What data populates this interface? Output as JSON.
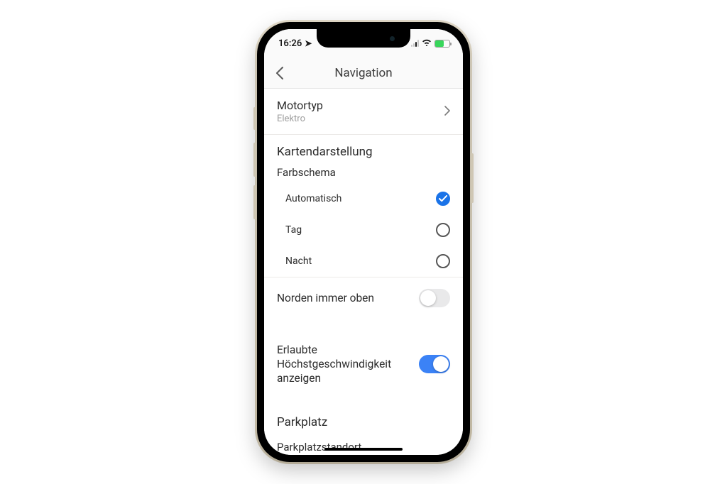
{
  "status": {
    "time": "16:26"
  },
  "header": {
    "title": "Navigation"
  },
  "engine": {
    "label": "Motortyp",
    "value": "Elektro"
  },
  "mapSection": {
    "title": "Kartendarstellung",
    "colorScheme": {
      "label": "Farbschema",
      "options": [
        {
          "label": "Automatisch",
          "checked": true
        },
        {
          "label": "Tag",
          "checked": false
        },
        {
          "label": "Nacht",
          "checked": false
        }
      ]
    },
    "northUp": {
      "label": "Norden immer oben",
      "value": false
    },
    "speedLimit": {
      "label": "Erlaubte Höchstgeschwindigkeit anzeigen",
      "value": true
    }
  },
  "parkSection": {
    "title": "Parkplatz",
    "cutoff": "Parkplatzstandort"
  }
}
